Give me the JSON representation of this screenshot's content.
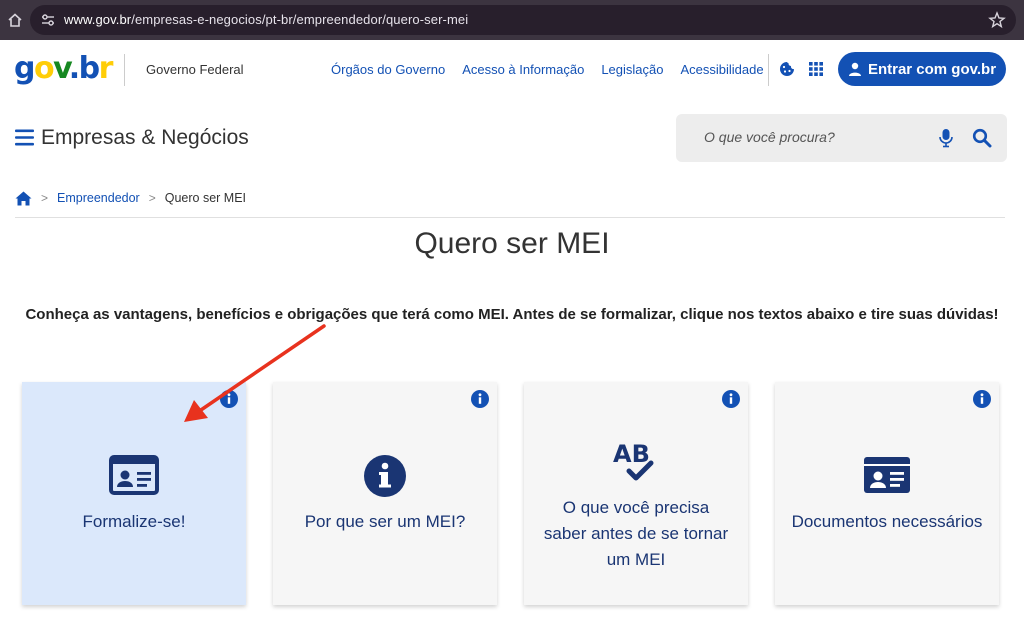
{
  "browser": {
    "url_host": "www.gov.br",
    "url_path": "/empresas-e-negocios/pt-br/empreendedor/quero-ser-mei"
  },
  "header": {
    "logo": {
      "g": "g",
      "o": "o",
      "v": "v",
      "dot": ".",
      "b": "b",
      "r": "r"
    },
    "gov_federal": "Governo Federal",
    "links": [
      "Órgãos do Governo",
      "Acesso à Informação",
      "Legislação",
      "Acessibilidade"
    ],
    "login_label": "Entrar com gov.br"
  },
  "section": {
    "title": "Empresas & Negócios",
    "search_placeholder": "O que você procura?"
  },
  "breadcrumb": {
    "separator": ">",
    "items": [
      "Empreendedor",
      "Quero ser MEI"
    ]
  },
  "page": {
    "title": "Quero ser MEI",
    "intro": "Conheça as vantagens, benefícios e obrigações que terá como MEI. Antes de se formalizar, clique nos textos abaixo e tire suas dúvidas!"
  },
  "cards": [
    {
      "label": "Formalize-se!",
      "icon": "id-card-icon"
    },
    {
      "label": "Por que ser um MEI?",
      "icon": "info-circle-icon"
    },
    {
      "label_lines": [
        "O que você precisa",
        "saber antes de se tornar",
        "um MEI"
      ],
      "icon": "spell-check-icon"
    },
    {
      "label": "Documentos necessários",
      "icon": "id-card-icon"
    }
  ],
  "colors": {
    "primary": "#1351b4",
    "card_icon": "#1a3573",
    "active_card": "#dbe8fb",
    "arrow": "#e8321e"
  }
}
